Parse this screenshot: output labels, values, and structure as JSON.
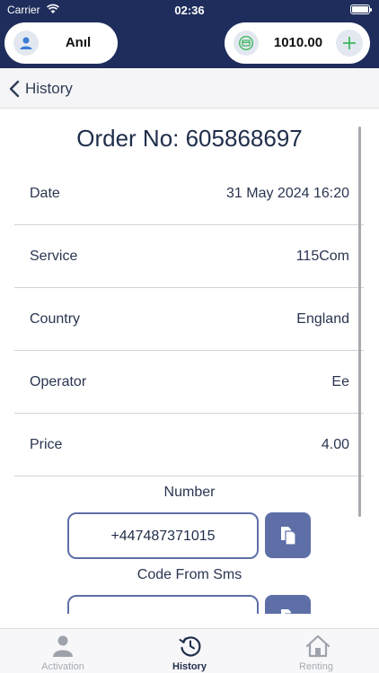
{
  "status_bar": {
    "carrier": "Carrier",
    "time": "02:36"
  },
  "header": {
    "user_name": "Anıl",
    "balance": "1010.00"
  },
  "nav": {
    "back_label": "History"
  },
  "order": {
    "title": "Order No: 605868697",
    "rows": [
      {
        "label": "Date",
        "value": "31 May 2024 16:20"
      },
      {
        "label": "Service",
        "value": "115Com"
      },
      {
        "label": "Country",
        "value": "England"
      },
      {
        "label": "Operator",
        "value": "Ee"
      },
      {
        "label": "Price",
        "value": "4.00"
      }
    ],
    "number_label": "Number",
    "number_value": "+447487371015",
    "code_label": "Code From Sms",
    "code_value": ""
  },
  "tabs": [
    {
      "label": "Activation",
      "icon": "person-icon",
      "active": false
    },
    {
      "label": "History",
      "icon": "history-icon",
      "active": true
    },
    {
      "label": "Renting",
      "icon": "home-icon",
      "active": false
    }
  ],
  "colors": {
    "header_bg": "#1f2d5c",
    "accent": "#5d6fa6",
    "balance_icon": "#3fb860"
  }
}
